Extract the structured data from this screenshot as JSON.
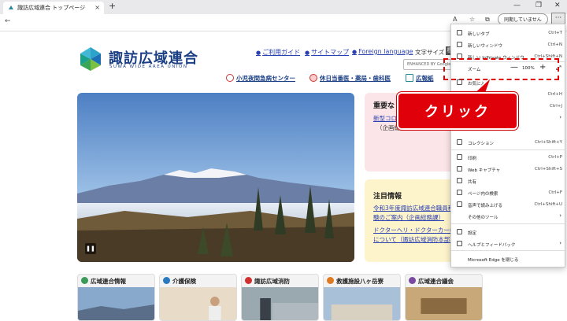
{
  "browser": {
    "tab_title": "諏訪広域連合 トップページ",
    "tab_close": "×",
    "new_tab": "+",
    "profile_label": "同期していません",
    "more_label": "···",
    "win_min": "—",
    "win_max": "❐",
    "win_close": "✕"
  },
  "site": {
    "logo_jp": "諏訪広域連合",
    "logo_en": "SUWA WIDE AREA UNION",
    "header_links": [
      "ご利用ガイド",
      "サイトマップ",
      "Foreign language"
    ],
    "text_size_label": "文字サイズ",
    "text_size_value": "標",
    "search_placeholder": "ENHANCED BY Google",
    "sub_links": [
      "小児夜間急病センター",
      "休日当番医・薬局・歯科医",
      "広報紙"
    ]
  },
  "notices": {
    "important_title": "重要な",
    "important_link": "新型コロ",
    "important_sub": "（企画総",
    "attention_title": "注目情報",
    "attention_links": [
      "令和3年度諏訪広域連合職員科",
      "験のご案内（企画総務課）",
      "ドクターヘリ・ドクターカー(",
      "について（諏訪広域消防本部)"
    ]
  },
  "cards": [
    {
      "label": "広域連合情報",
      "color": "#3a9a5a"
    },
    {
      "label": "介護保険",
      "color": "#2a7ac0"
    },
    {
      "label": "諏訪広域消防",
      "color": "#d03030"
    },
    {
      "label": "救護施設八ヶ岳寮",
      "color": "#e07a20"
    },
    {
      "label": "広域連合議会",
      "color": "#7a4aa0"
    }
  ],
  "callout": {
    "text": "クリック"
  },
  "menu": {
    "items": [
      {
        "label": "新しいタブ",
        "shortcut": "Ctrl+T"
      },
      {
        "label": "新しいウィンドウ",
        "shortcut": "Ctrl+N"
      },
      {
        "label": "新しい InPrivate ウィンドウ",
        "shortcut": "Ctrl+Shift+N"
      },
      {
        "label": "お気に入り",
        "shortcut": ""
      },
      {
        "label": "",
        "shortcut": "Ctrl+H"
      },
      {
        "label": "",
        "shortcut": "Ctrl+J"
      },
      {
        "label": "",
        "shortcut": ""
      },
      {
        "label": "コレクション",
        "shortcut": "Ctrl+Shift+Y"
      },
      {
        "label": "印刷",
        "shortcut": "Ctrl+P"
      },
      {
        "label": "Web キャプチャ",
        "shortcut": "Ctrl+Shift+S"
      },
      {
        "label": "共有",
        "shortcut": ""
      },
      {
        "label": "ページ内の検索",
        "shortcut": "Ctrl+F"
      },
      {
        "label": "音声で読み上げる",
        "shortcut": "Ctrl+Shift+U"
      },
      {
        "label": "その他のツール",
        "shortcut": ""
      },
      {
        "label": "設定",
        "shortcut": ""
      },
      {
        "label": "ヘルプとフィードバック",
        "shortcut": ""
      },
      {
        "label": "Microsoft Edge を閉じる",
        "shortcut": ""
      }
    ],
    "zoom_label": "ズーム",
    "zoom_minus": "—",
    "zoom_value": "100%",
    "zoom_plus": "+",
    "zoom_full": "⤢",
    "arrow": "›"
  }
}
